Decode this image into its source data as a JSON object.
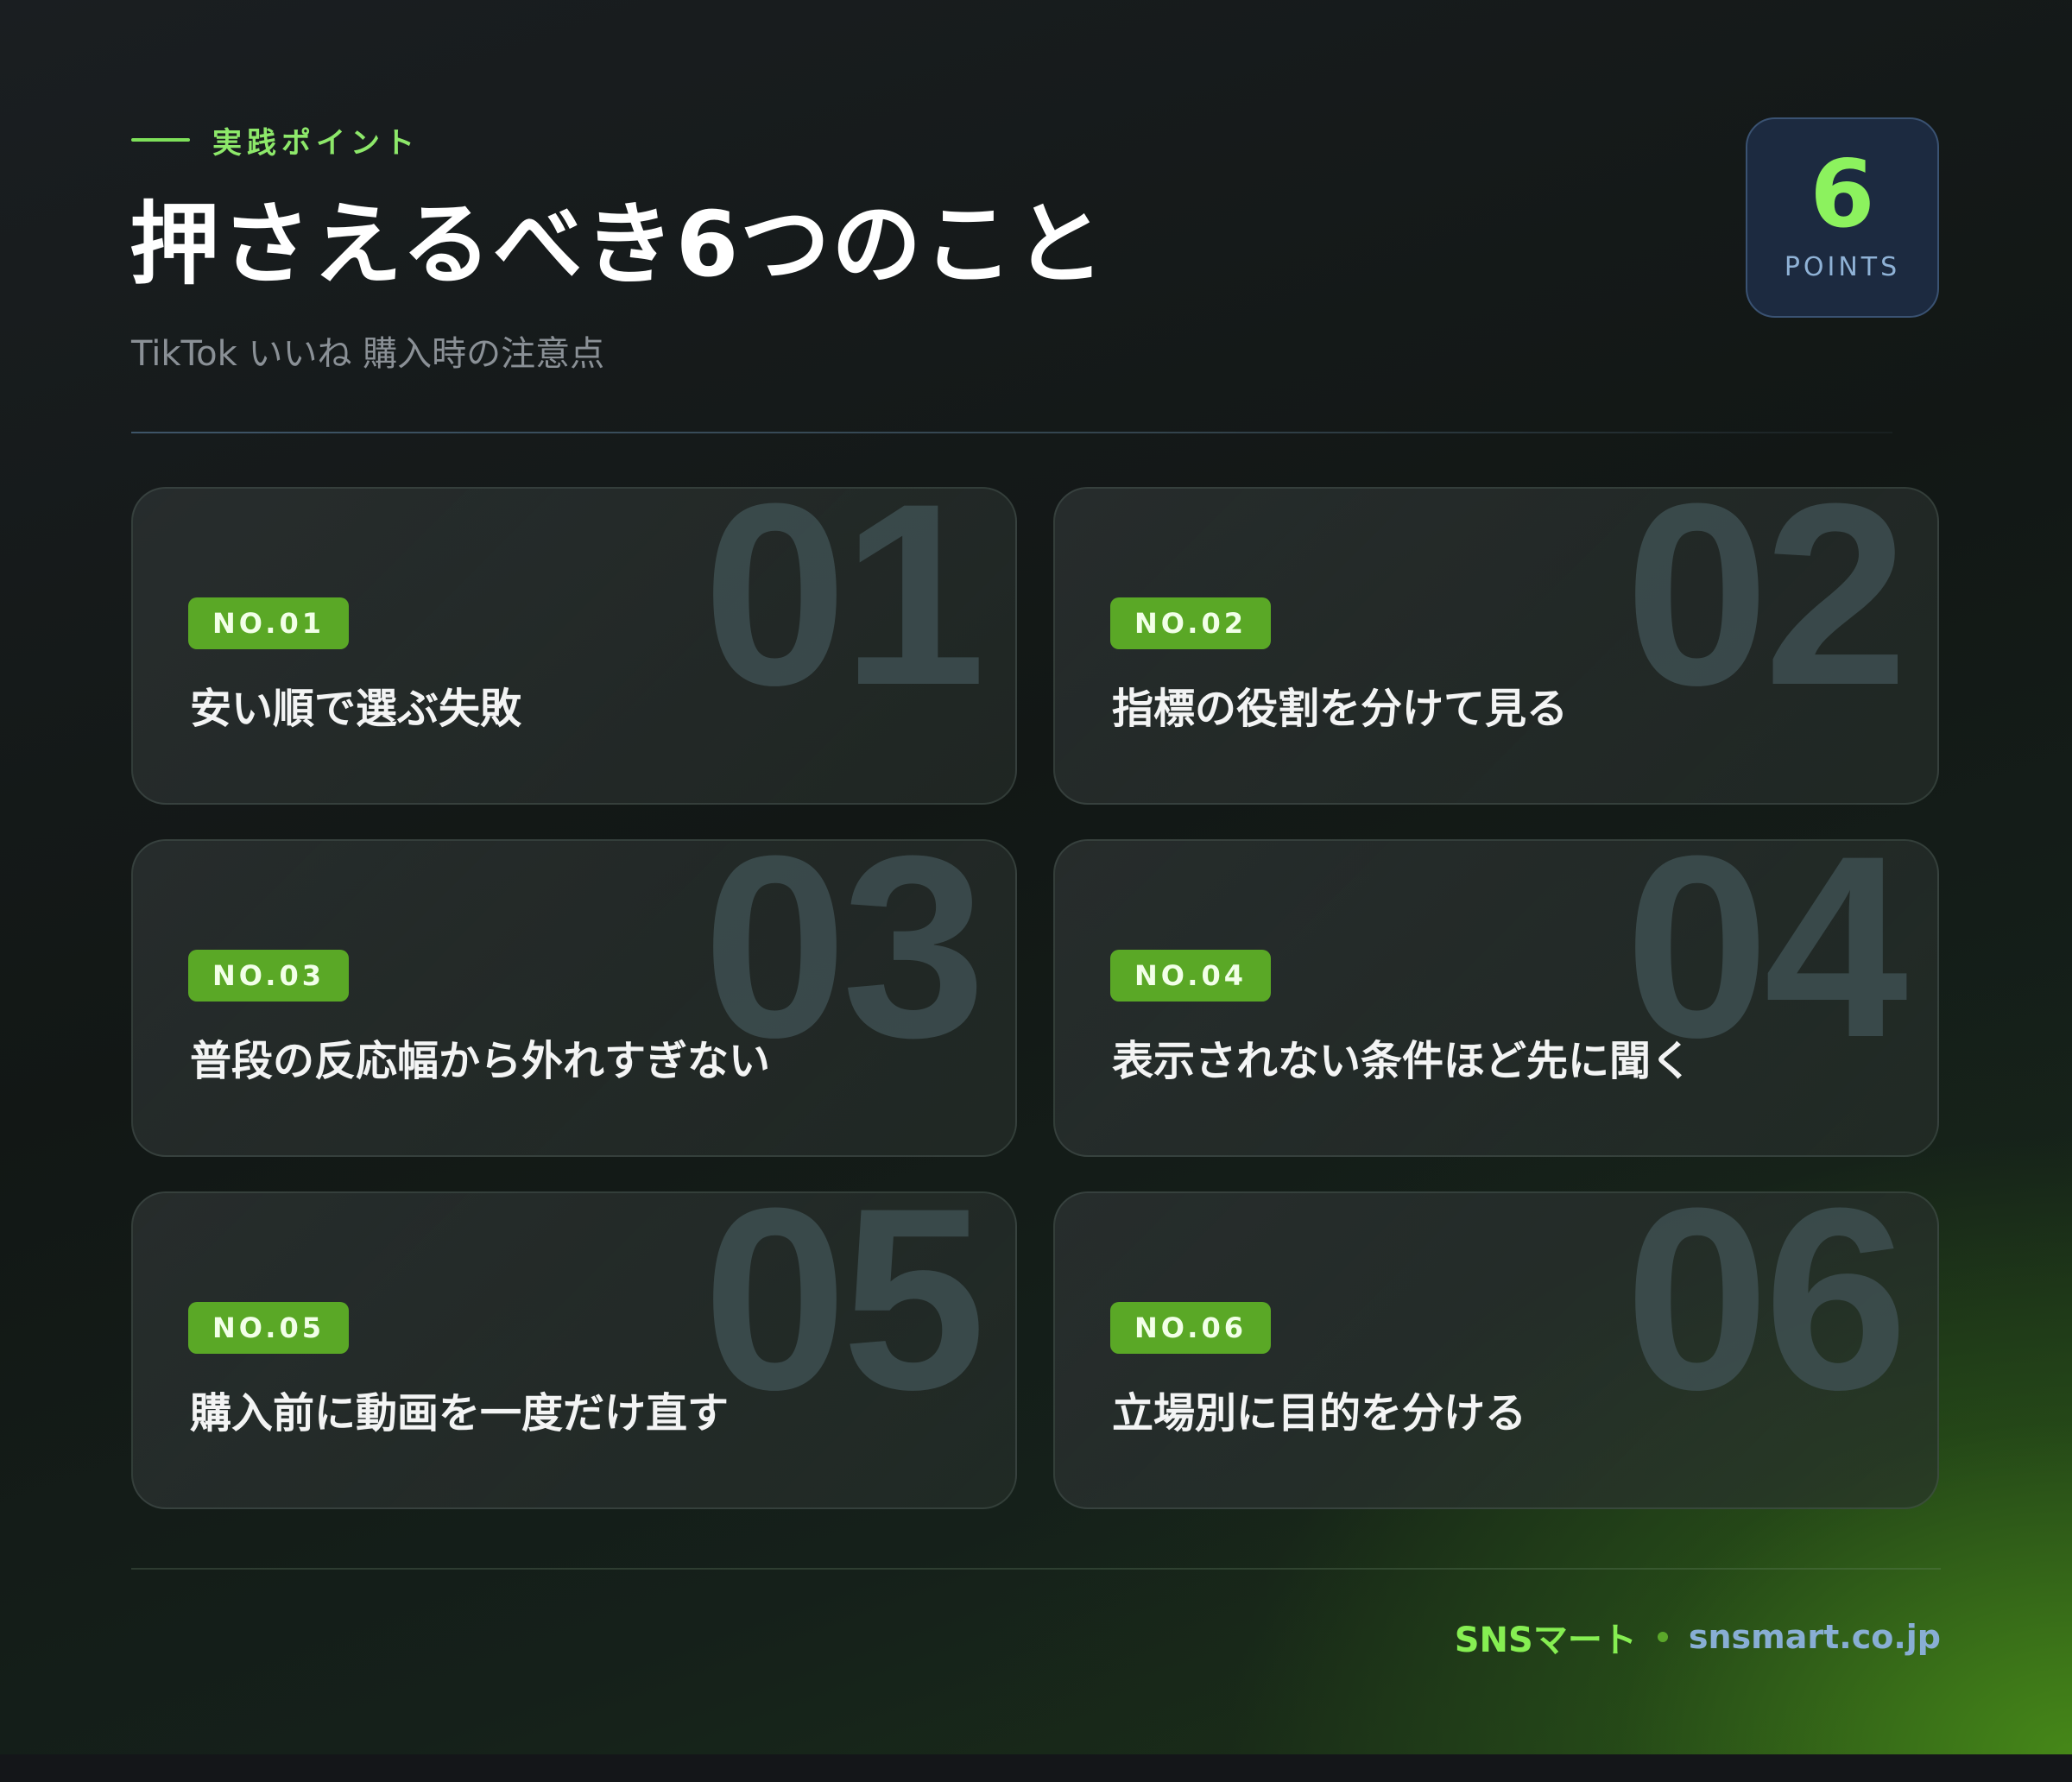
{
  "header": {
    "eyebrow": "実践ポイント",
    "title": "押さえるべき6つのこと",
    "subtitle": "TikTok いいね 購入時の注意点"
  },
  "badge": {
    "number": "6",
    "label": "POINTS"
  },
  "cards": [
    {
      "bignum": "01",
      "tag": "NO.01",
      "title": "安い順で選ぶ失敗"
    },
    {
      "bignum": "02",
      "tag": "NO.02",
      "title": "指標の役割を分けて見る"
    },
    {
      "bignum": "03",
      "tag": "NO.03",
      "title": "普段の反応幅から外れすぎない"
    },
    {
      "bignum": "04",
      "tag": "NO.04",
      "title": "表示されない条件ほど先に聞く"
    },
    {
      "bignum": "05",
      "tag": "NO.05",
      "title": "購入前に動画を一度だけ直す"
    },
    {
      "bignum": "06",
      "tag": "NO.06",
      "title": "立場別に目的を分ける"
    }
  ],
  "footer": {
    "brand": "SNSマート",
    "url": "snsmart.co.jp"
  },
  "colors": {
    "accent_green": "#8de86a",
    "tag_green": "#5aa826",
    "badge_bg": "#1c2a40",
    "url_blue": "#88aed4"
  }
}
